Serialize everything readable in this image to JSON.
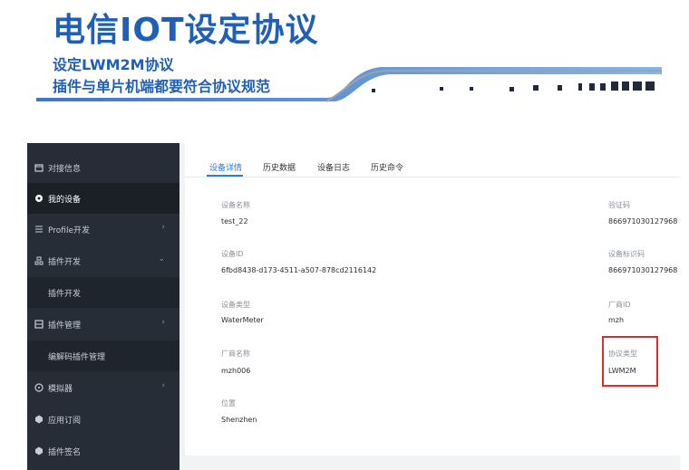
{
  "header": {
    "title": "电信IOT设定协议",
    "subtitle_line1": "设定LWM2M协议",
    "subtitle_line2": "插件与单片机端都要符合协议规范"
  },
  "sidebar": {
    "items": [
      {
        "label": "对接信息",
        "icon": "dock-icon"
      },
      {
        "label": "我的设备",
        "icon": "device-icon",
        "active": true
      },
      {
        "label": "Profile开发",
        "icon": "list-icon",
        "arrow": "›"
      },
      {
        "label": "插件开发",
        "icon": "plugin-icon",
        "arrow": "⌄"
      },
      {
        "label": "插件开发",
        "sub": true
      },
      {
        "label": "插件管理",
        "icon": "manage-icon",
        "arrow": "›"
      },
      {
        "label": "编解码插件管理",
        "sub": true
      },
      {
        "label": "模拟器",
        "icon": "simulator-icon",
        "arrow": "›"
      },
      {
        "label": "应用订阅",
        "icon": "subscribe-icon"
      },
      {
        "label": "插件签名",
        "icon": "sign-icon"
      }
    ]
  },
  "tabs": [
    "设备详情",
    "历史数据",
    "设备日志",
    "历史命令"
  ],
  "fields": {
    "device_name": {
      "label": "设备名称",
      "value": "test_22"
    },
    "verify_code": {
      "label": "验证码",
      "value": "866971030127968"
    },
    "device_id": {
      "label": "设备ID",
      "value": "6fbd8438-d173-4511-a507-878cd2116142"
    },
    "device_identifier": {
      "label": "设备标识码",
      "value": "866971030127968"
    },
    "device_type": {
      "label": "设备类型",
      "value": "WaterMeter"
    },
    "manufacturer_id": {
      "label": "厂商ID",
      "value": "mzh"
    },
    "manufacturer_name": {
      "label": "厂商名称",
      "value": "mzh006"
    },
    "protocol_type": {
      "label": "协议类型",
      "value": "LWM2M"
    },
    "location": {
      "label": "位置",
      "value": "Shenzhen"
    }
  },
  "colors": {
    "accent": "#2c7be5",
    "title": "#1f5fb7",
    "sidebar_bg": "#262d36",
    "highlight": "#e02b2b"
  }
}
